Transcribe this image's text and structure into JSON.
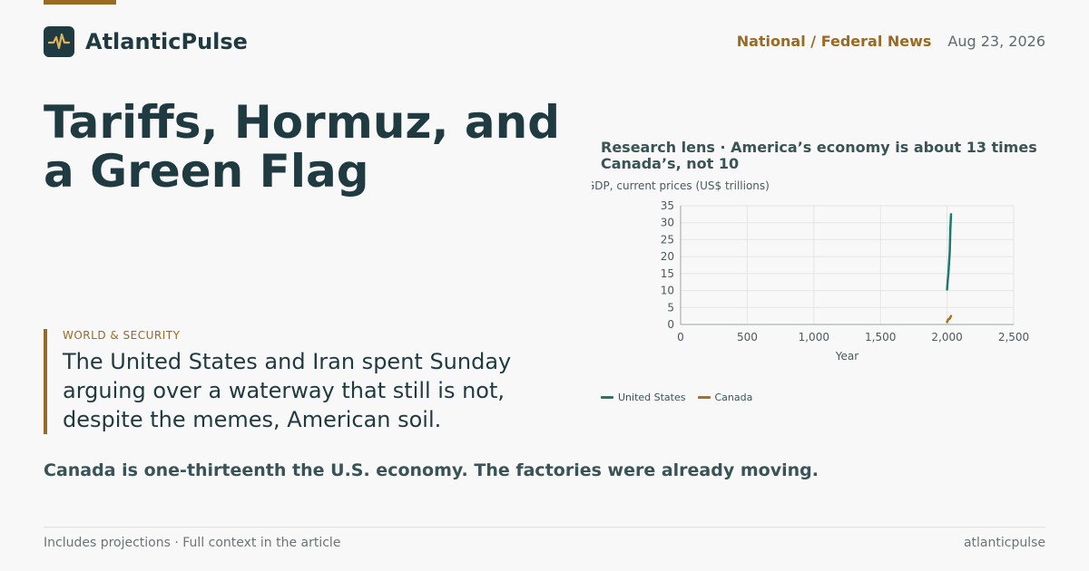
{
  "brand": {
    "name": "AtlanticPulse",
    "logo_icon": "pulse-icon"
  },
  "header": {
    "section": "National / Federal News",
    "date": "Aug 23, 2026"
  },
  "article": {
    "headline": "Tariffs, Hormuz, and a Green Flag",
    "kicker": "WORLD & SECURITY",
    "dek": "The United States and Iran spent Sunday arguing over a waterway that still is not, despite the memes, American soil.",
    "standfirst": "Canada is one-thirteenth the U.S. economy. The factories were already moving."
  },
  "footer": {
    "note": "Includes projections · Full context in the article",
    "site": "atlanticpulse"
  },
  "colors": {
    "accent": "#9a6a22",
    "ink": "#1f3a40",
    "us_series": "#1f7a6e",
    "canada_series": "#a8701f"
  },
  "chart_data": {
    "type": "line",
    "title": "Research lens · America’s economy is about 13 times Canada’s, not 10",
    "subtitle": "GDP, current prices (US$ trillions)",
    "xlabel": "Year",
    "ylabel": "",
    "xlim": [
      0,
      2500
    ],
    "ylim": [
      0,
      35
    ],
    "x_ticks": [
      "0",
      "500",
      "1,000",
      "1,500",
      "2,000",
      "2,500"
    ],
    "y_ticks": [
      "0",
      "5",
      "10",
      "15",
      "20",
      "25",
      "30",
      "35"
    ],
    "grid": true,
    "legend_position": "bottom-left",
    "series": [
      {
        "name": "United States",
        "color": "#1f7a6e",
        "x": [
          2000,
          2005,
          2010,
          2015,
          2020,
          2025,
          2030
        ],
        "y": [
          10.3,
          13.0,
          15.0,
          18.2,
          21.3,
          28.5,
          32.5
        ]
      },
      {
        "name": "Canada",
        "color": "#a8701f",
        "x": [
          2000,
          2005,
          2010,
          2015,
          2020,
          2025,
          2030
        ],
        "y": [
          0.7,
          1.2,
          1.6,
          1.6,
          1.7,
          2.2,
          2.5
        ]
      }
    ]
  }
}
